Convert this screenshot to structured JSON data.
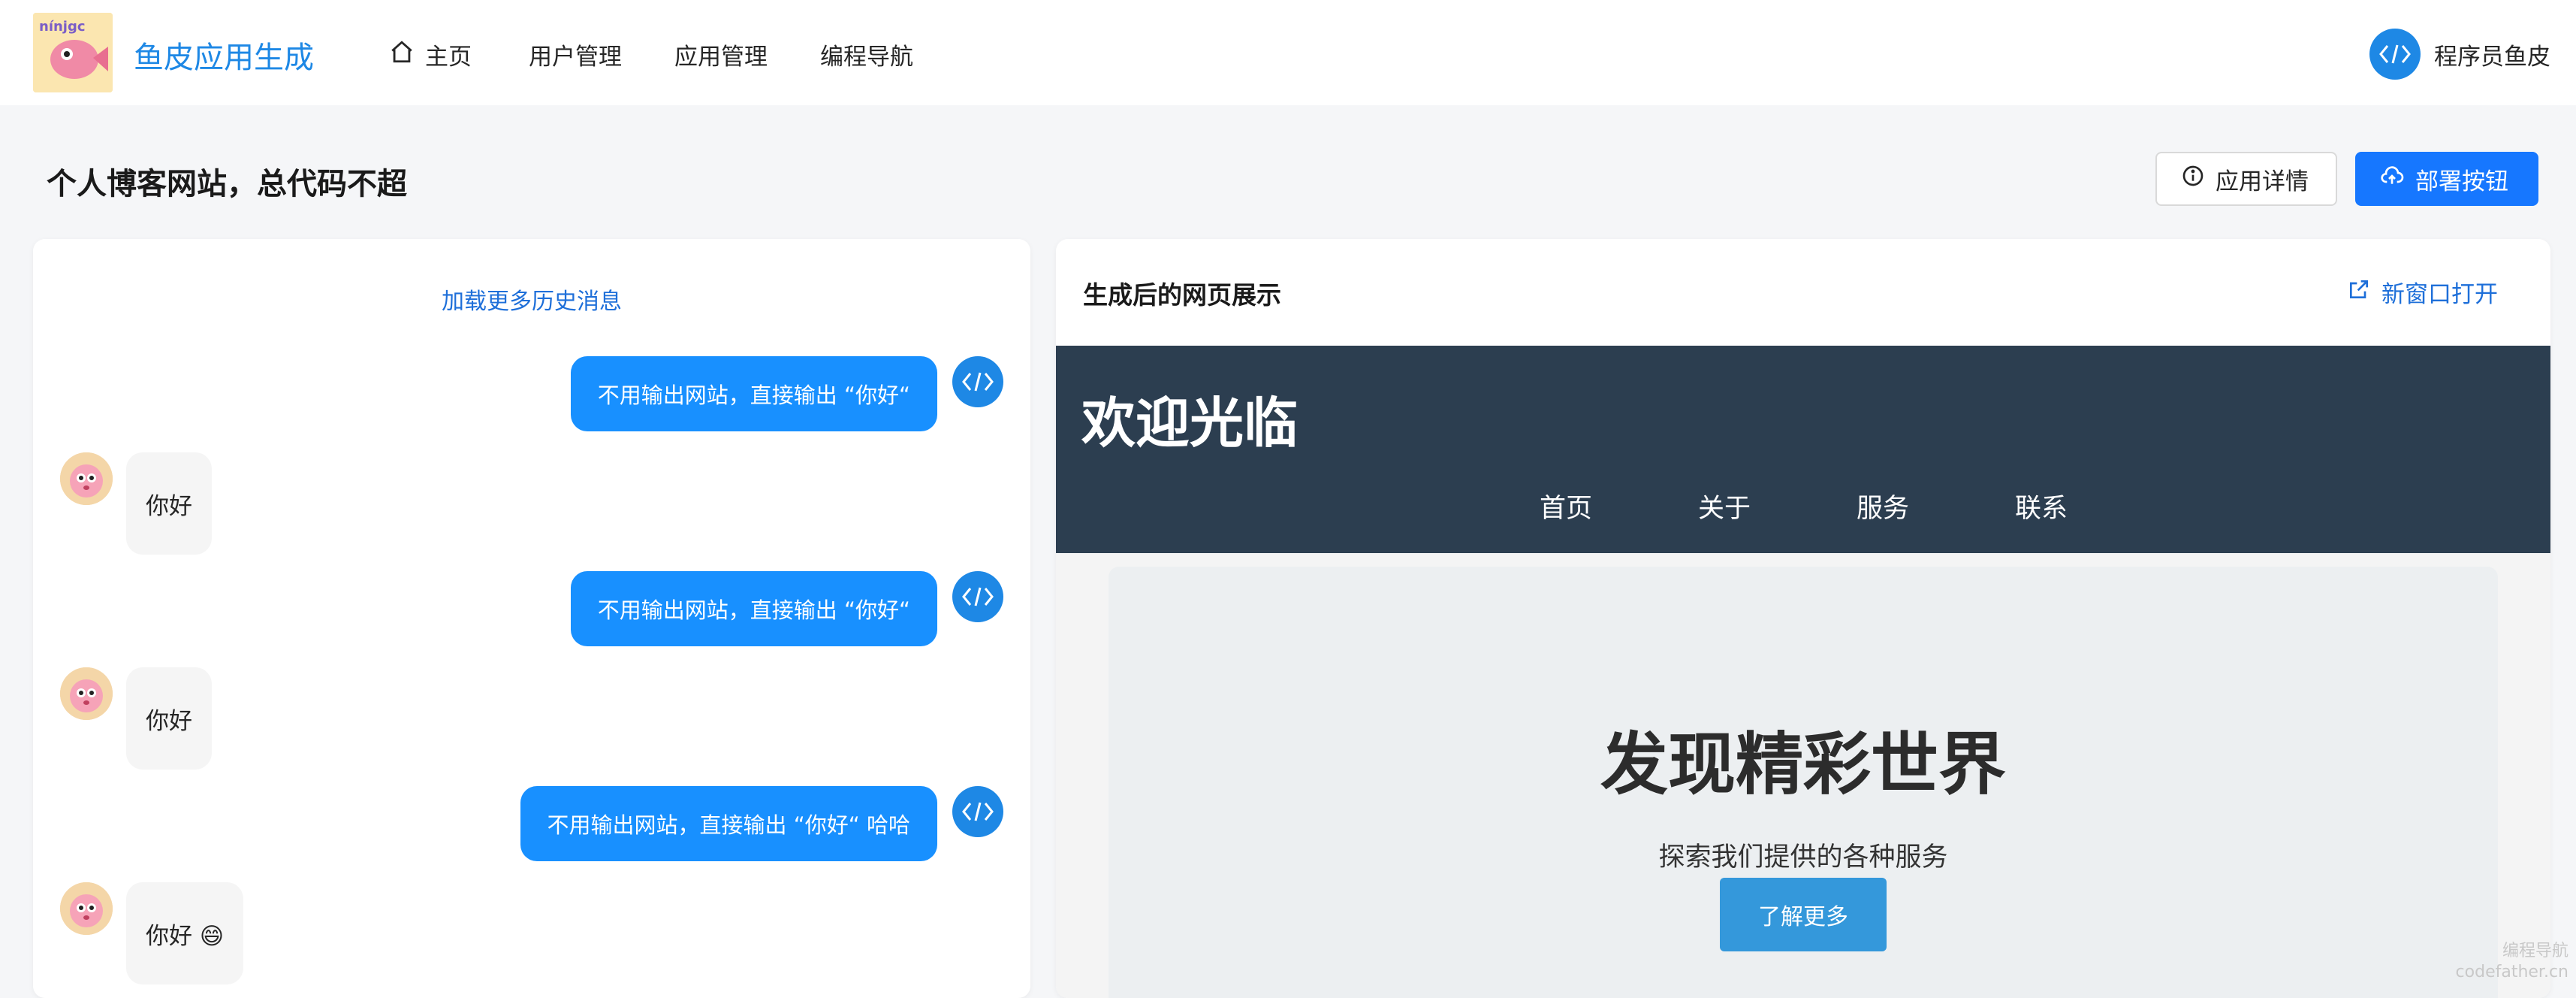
{
  "app": {
    "brand": "鱼皮应用生成",
    "logo_text": "ninjgc"
  },
  "nav": {
    "items": [
      {
        "label": "主页",
        "icon": "home-icon"
      },
      {
        "label": "用户管理"
      },
      {
        "label": "应用管理"
      },
      {
        "label": "编程导航"
      }
    ]
  },
  "user": {
    "name": "程序员鱼皮"
  },
  "page": {
    "title": "个人博客网站，总代码不超",
    "detail_button": "应用详情",
    "deploy_button": "部署按钮"
  },
  "chat": {
    "load_more": "加载更多历史消息",
    "messages": [
      {
        "role": "user",
        "text": "不用输出网站，直接输出 “你好“"
      },
      {
        "role": "ai",
        "text": "你好"
      },
      {
        "role": "user",
        "text": "不用输出网站，直接输出 “你好“"
      },
      {
        "role": "ai",
        "text": "你好"
      },
      {
        "role": "user",
        "text": "不用输出网站，直接输出 “你好“ 哈哈"
      },
      {
        "role": "ai",
        "text": "你好 😄"
      }
    ]
  },
  "preview": {
    "title": "生成后的网页展示",
    "open_new_window": "新窗口打开",
    "site": {
      "brand": "欢迎光临",
      "nav": [
        "首页",
        "关于",
        "服务",
        "联系"
      ],
      "hero_title": "发现精彩世界",
      "hero_subtitle": "探索我们提供的各种服务",
      "hero_button": "了解更多"
    }
  },
  "watermark": {
    "line1": "编程导航",
    "line2": "codefather.cn"
  },
  "colors": {
    "primary": "#1677ff",
    "brand_blue": "#1e88e5",
    "site_header": "#2c3e50",
    "hero_button": "#3498db"
  }
}
